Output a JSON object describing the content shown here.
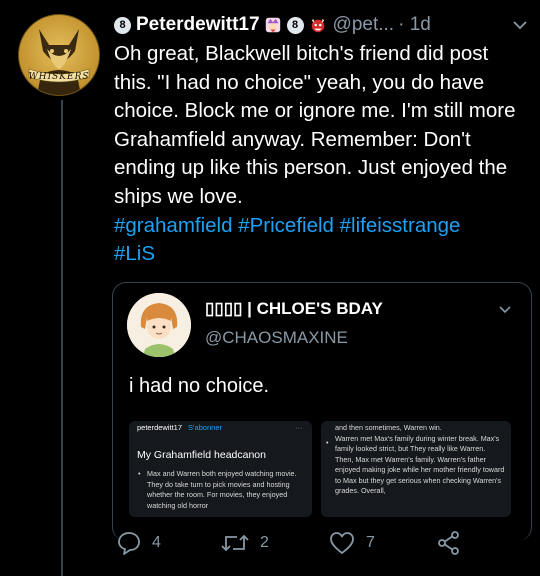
{
  "tweet": {
    "author": {
      "badge_number": "8",
      "display_name": "Peterdewitt17",
      "handle": "@pet...",
      "avatar_text": "WHISKERS"
    },
    "time": "· 1d",
    "text_plain": "Oh great, Blackwell bitch's friend did post this. \"I had no choice\" yeah, you do have choice. Block me or ignore me. I'm still more Grahamfield anyway. Remember: Don't ending up like this person. Just enjoyed the ships we love.\n",
    "hashtags": [
      "#grahamfield",
      "#Pricefield",
      "#lifeisstrange",
      "#LiS"
    ]
  },
  "quote": {
    "name": "▯▯▯▯ | CHLOE'S BDAY",
    "handle": "@CHAOSMAXINE",
    "text": "i had no choice.",
    "image_left": {
      "user": "peterdewitt17",
      "follow": "S'abonner",
      "dots": "···",
      "title": "My Grahamfield headcanon",
      "body": "Max and Warren both enjoyed watching movie. They do take turn to pick movies and hosting whether the room. For movies, they enjoyed watching old horror"
    },
    "image_right": {
      "body": "and then sometimes, Warren win.\nWarren met Max's family during winter break. Max's family looked strict, but They really like Warren. Then, Max met Warren's family. Warren's father enjoyed making joke while her mother friendly toward to Max but they get serious when checking Warren's grades. Overall,"
    }
  },
  "actions": {
    "reply_count": "4",
    "retweet_count": "2",
    "like_count": "7"
  },
  "colors": {
    "background": "#000000",
    "accent": "#1da1f2",
    "muted": "#8899a6",
    "border": "#38444d"
  },
  "icons": [
    "badge-icon",
    "jester-emoji-icon",
    "oni-emoji-icon",
    "chevron-down-icon",
    "reply-icon",
    "retweet-icon",
    "like-icon",
    "share-icon"
  ]
}
